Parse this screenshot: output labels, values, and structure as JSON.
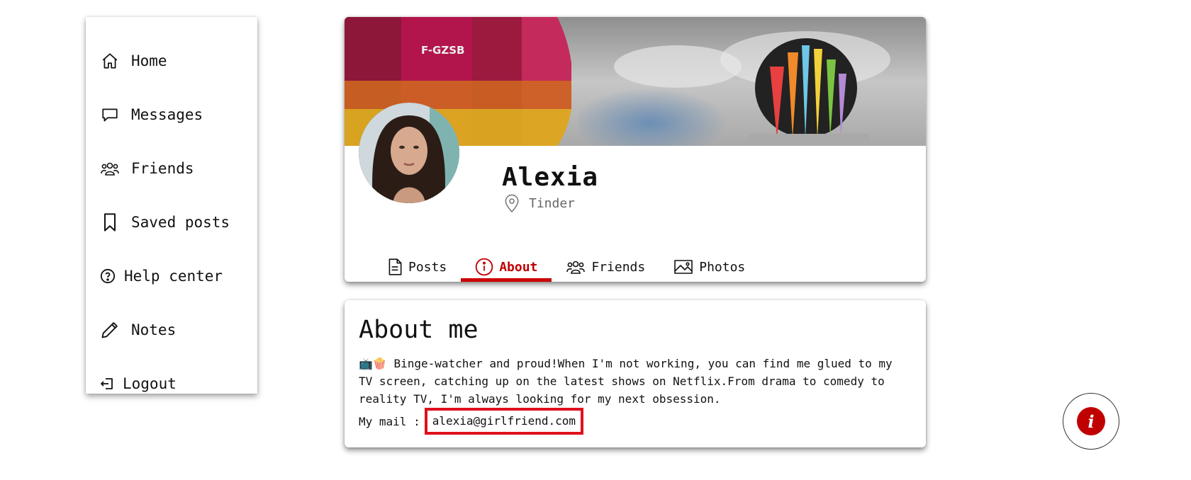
{
  "sidebar": {
    "items": [
      {
        "label": "Home",
        "icon": "home-icon"
      },
      {
        "label": "Messages",
        "icon": "message-icon"
      },
      {
        "label": "Friends",
        "icon": "friends-icon"
      },
      {
        "label": "Saved posts",
        "icon": "bookmark-icon"
      },
      {
        "label": "Help center",
        "icon": "help-icon"
      },
      {
        "label": "Notes",
        "icon": "pencil-icon"
      },
      {
        "label": "Logout",
        "icon": "logout-icon"
      }
    ]
  },
  "profile": {
    "cover_text": "F-GZSB",
    "name": "Alexia",
    "location": "Tinder"
  },
  "tabs": [
    {
      "label": "Posts",
      "icon": "document-icon",
      "active": false
    },
    {
      "label": "About",
      "icon": "info-icon",
      "active": true
    },
    {
      "label": "Friends",
      "icon": "friends-icon",
      "active": false
    },
    {
      "label": "Photos",
      "icon": "image-icon",
      "active": false
    }
  ],
  "about": {
    "title": "About me",
    "bio": "📺🍿 Binge-watcher and proud!When I'm not working, you can find me glued to my TV screen, catching up on the latest shows on Netflix.From drama to comedy to reality TV, I'm always looking for my next obsession.",
    "mail_label": "My mail :",
    "mail_value": "alexia@girlfriend.com"
  },
  "colors": {
    "accent": "#cc0000",
    "highlight_box": "#e0101e",
    "muted_text": "#666666"
  }
}
